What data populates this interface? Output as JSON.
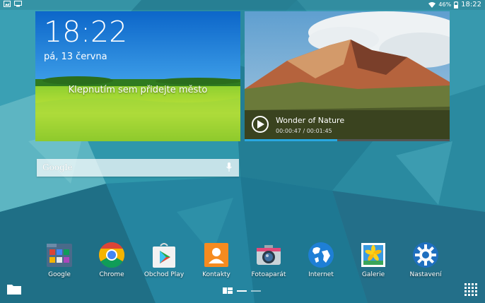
{
  "status_bar": {
    "left_icons": [
      "gallery-notification-icon",
      "screen-mirroring-icon"
    ],
    "right_icons": [
      "wifi-icon",
      "battery-icon"
    ],
    "battery": "46%",
    "time": "18:22"
  },
  "clock_widget": {
    "time": "18:22",
    "date": "pá, 13 června",
    "city_prompt": "Klepnutím sem přidejte město"
  },
  "video_widget": {
    "title": "Wonder of Nature",
    "time": "00:00:47 / 00:01:45",
    "progress": 0.45
  },
  "google_search": {
    "logo": "Google",
    "icon": "mic-icon"
  },
  "apps": [
    {
      "label": "Google",
      "icon": "google-folder-icon"
    },
    {
      "label": "Chrome",
      "icon": "chrome-icon"
    },
    {
      "label": "Obchod Play",
      "icon": "play-store-icon"
    },
    {
      "label": "Kontakty",
      "icon": "contacts-icon"
    },
    {
      "label": "Fotoaparát",
      "icon": "camera-icon"
    },
    {
      "label": "Internet",
      "icon": "internet-globe-icon"
    },
    {
      "label": "Galerie",
      "icon": "gallery-icon"
    },
    {
      "label": "Nastavení",
      "icon": "settings-gear-icon"
    }
  ],
  "colors": {
    "wallpaper": "#2f8fa5",
    "progress": "#29a7e1"
  }
}
